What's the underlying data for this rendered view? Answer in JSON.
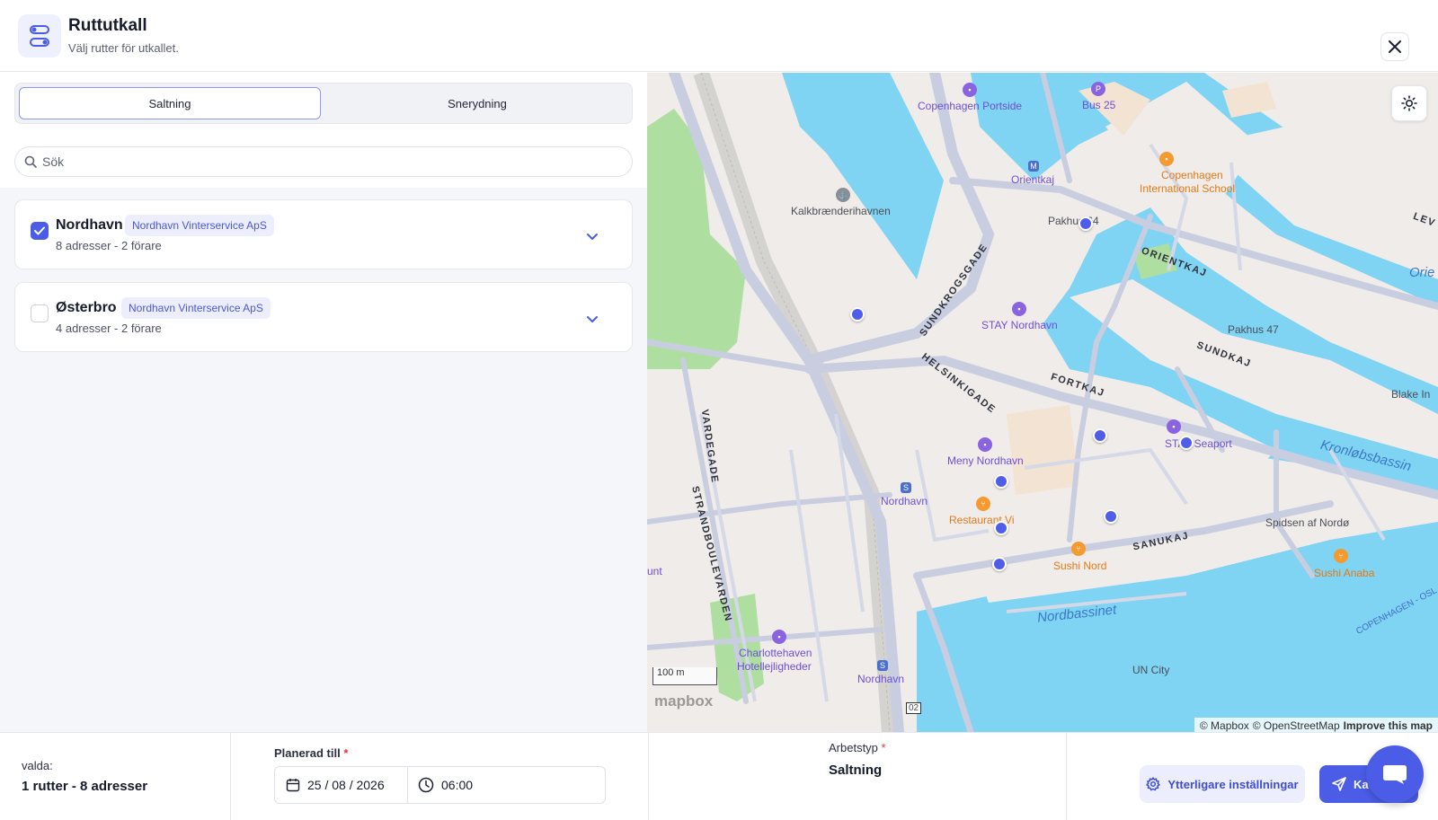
{
  "header": {
    "title": "Ruttutkall",
    "subtitle": "Välj rutter för utkallet.",
    "icon": "route-icon"
  },
  "tabs": [
    {
      "label": "Saltning",
      "active": true
    },
    {
      "label": "Snerydning",
      "active": false
    }
  ],
  "search": {
    "placeholder": "Sök",
    "value": ""
  },
  "routes": [
    {
      "name": "Nordhavn",
      "tag": "Nordhavn Vinterservice ApS",
      "meta": "8 adresser - 2 förare",
      "checked": true
    },
    {
      "name": "Østerbro",
      "tag": "Nordhavn Vinterservice ApS",
      "meta": "4 adresser - 2 förare",
      "checked": false
    }
  ],
  "map": {
    "labels": {
      "copenhagen_portside": "Copenhagen Portside",
      "bus25": "Bus 25",
      "orientkaj_station": "Orientkaj",
      "cis_line1": "Copenhagen",
      "cis_line2": "International School",
      "kalkbraenderihavnen": "Kalkbrænderihavnen",
      "pakhus64": "Pakhus 64",
      "sundkrogsgade": "SUNDKROGSGADE",
      "orientkaj_street": "ORIENTKAJ",
      "stay_nordhavn": "STAY Nordhavn",
      "pakhus47": "Pakhus 47",
      "sundkaj": "SUNDKAJ",
      "helsinkigade": "HELSINKIGADE",
      "fortkaj": "FORTKAJ",
      "blake": "Blake In",
      "orient_water": "Orie",
      "lev": "LEV",
      "stay_seaport": "STAY Seaport",
      "kronlobsbassin": "Kronløbsbassin",
      "meny_nordhavn": "Meny Nordhavn",
      "vardegade": "VARDEGADE",
      "nordhavn_station": "Nordhavn",
      "restaurant_vi": "Restaurant Vi",
      "spidsen": "Spidsen af Nordø",
      "sushi_nord": "Sushi Nord",
      "sanukaj": "SANUKAJ",
      "sushi_anaba": "Sushi Anaba",
      "strandboulevarden": "STRANDBOULEVARDEN",
      "unt": "unt",
      "nordbassinet": "Nordbassinet",
      "copenhagen_osl": "COPENHAGEN - OSL",
      "charlottehaven_line1": "Charlottehaven",
      "charlottehaven_line2": "Hotellejligheder",
      "un_city": "UN City",
      "nordhavn_station2": "Nordhavn",
      "road_02": "02"
    },
    "scale": "100 m",
    "logo": "mapbox",
    "attribution": {
      "mapbox": "© Mapbox",
      "osm": "© OpenStreetMap",
      "improve": "Improve this map"
    }
  },
  "footer": {
    "selected_label": "valda:",
    "selected_value": "1 rutter - 8 adresser",
    "planned_label": "Planerad till",
    "required_mark": "*",
    "date": "25 / 08 / 2026",
    "time": "06:00",
    "work_type_label": "Arbetstyp",
    "work_type_value": "Saltning",
    "settings_button": "Ytterligare inställningar",
    "send_button": "Ka"
  },
  "colors": {
    "accent": "#4b5ce7",
    "water": "#7fd3f3",
    "park": "#aedea0",
    "road": "#c9cde0"
  }
}
